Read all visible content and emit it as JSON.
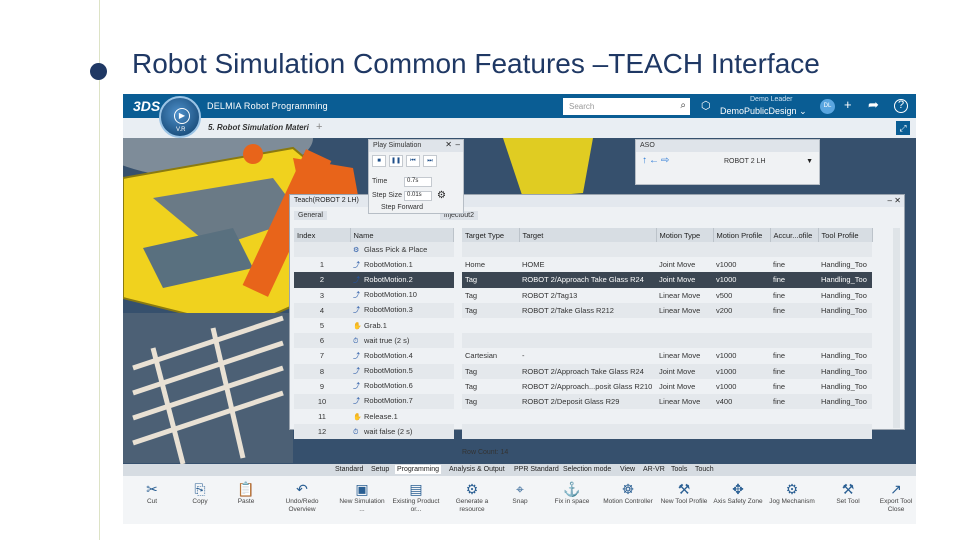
{
  "slide": {
    "title": "Robot Simulation Common Features –TEACH Interface"
  },
  "app": {
    "brand": "DELMIA Robot Programming",
    "logo": "3DS",
    "compass_version": "V.R",
    "search_placeholder": "Search",
    "user_role": "Demo Leader",
    "user_space": "DemoPublicDesign",
    "avatar_initials": "DL",
    "document_tab": "5. Robot Simulation Materi",
    "accent": "#0a5d94"
  },
  "play_simulation": {
    "title": "Play Simulation",
    "time_label": "Time",
    "time_value": "0.7s",
    "step_label": "Step Size",
    "step_value": "0.01s",
    "step_forward": "Step Forward"
  },
  "aso": {
    "title": "ASO",
    "robot": "ROBOT 2 LH"
  },
  "teach": {
    "title": "Teach(ROBOT 2 LH)",
    "tab_general": "General",
    "tab_other": "lnjectout2",
    "left_headers": [
      "Index",
      "Name"
    ],
    "right_headers": [
      "Target Type",
      "Target",
      "Motion Type",
      "Motion Profile",
      "Accur...ofile",
      "Tool Profile"
    ],
    "rows": [
      {
        "index": "",
        "name": "Glass Pick & Place",
        "target_type": "",
        "target": "",
        "motion_type": "",
        "motion_profile": "",
        "accuracy": "",
        "tool": ""
      },
      {
        "index": "1",
        "name": "RobotMotion.1",
        "target_type": "Home",
        "target": "HOME",
        "motion_type": "Joint Move",
        "motion_profile": "v1000",
        "accuracy": "fine",
        "tool": "Handling_Too"
      },
      {
        "index": "2",
        "name": "RobotMotion.2",
        "target_type": "Tag",
        "target": "ROBOT 2/Approach Take Glass R24",
        "motion_type": "Joint Move",
        "motion_profile": "v1000",
        "accuracy": "fine",
        "tool": "Handling_Too"
      },
      {
        "index": "3",
        "name": "RobotMotion.10",
        "target_type": "Tag",
        "target": "ROBOT 2/Tag13",
        "motion_type": "Linear Move",
        "motion_profile": "v500",
        "accuracy": "fine",
        "tool": "Handling_Too"
      },
      {
        "index": "4",
        "name": "RobotMotion.3",
        "target_type": "Tag",
        "target": "ROBOT 2/Take Glass R212",
        "motion_type": "Linear Move",
        "motion_profile": "v200",
        "accuracy": "fine",
        "tool": "Handling_Too"
      },
      {
        "index": "5",
        "name": "Grab.1",
        "target_type": "",
        "target": "",
        "motion_type": "",
        "motion_profile": "",
        "accuracy": "",
        "tool": ""
      },
      {
        "index": "6",
        "name": "wait true (2 s)",
        "target_type": "",
        "target": "",
        "motion_type": "",
        "motion_profile": "",
        "accuracy": "",
        "tool": ""
      },
      {
        "index": "7",
        "name": "RobotMotion.4",
        "target_type": "Cartesian",
        "target": "-",
        "motion_type": "Linear Move",
        "motion_profile": "v1000",
        "accuracy": "fine",
        "tool": "Handling_Too"
      },
      {
        "index": "8",
        "name": "RobotMotion.5",
        "target_type": "Tag",
        "target": "ROBOT 2/Approach Take Glass R24",
        "motion_type": "Joint Move",
        "motion_profile": "v1000",
        "accuracy": "fine",
        "tool": "Handling_Too"
      },
      {
        "index": "9",
        "name": "RobotMotion.6",
        "target_type": "Tag",
        "target": "ROBOT 2/Approach...posit Glass R210",
        "motion_type": "Joint Move",
        "motion_profile": "v1000",
        "accuracy": "fine",
        "tool": "Handling_Too"
      },
      {
        "index": "10",
        "name": "RobotMotion.7",
        "target_type": "Tag",
        "target": "ROBOT 2/Deposit Glass R29",
        "motion_type": "Linear Move",
        "motion_profile": "v400",
        "accuracy": "fine",
        "tool": "Handling_Too"
      },
      {
        "index": "11",
        "name": "Release.1",
        "target_type": "",
        "target": "",
        "motion_type": "",
        "motion_profile": "",
        "accuracy": "",
        "tool": ""
      },
      {
        "index": "12",
        "name": "wait false (2 s)",
        "target_type": "",
        "target": "",
        "motion_type": "",
        "motion_profile": "",
        "accuracy": "",
        "tool": ""
      }
    ],
    "row_count_label": "Row Count:",
    "row_count": "14"
  },
  "ribbon_tabs": [
    "Standard",
    "Setup",
    "Programming",
    "Analysis & Output",
    "PPR Standard",
    "Selection mode",
    "View",
    "AR-VR",
    "Tools",
    "Touch"
  ],
  "ribbon_tools": [
    {
      "label": "Cut",
      "icon": "scissors-icon"
    },
    {
      "label": "Copy",
      "icon": "copy-icon"
    },
    {
      "label": "Paste",
      "icon": "paste-icon"
    },
    {
      "label": "Undo/Redo Overview",
      "icon": "undo-icon"
    },
    {
      "label": "New Simulation ...",
      "icon": "simulation-icon"
    },
    {
      "label": "Existing Product or...",
      "icon": "product-icon"
    },
    {
      "label": "Generate a resource",
      "icon": "resource-icon"
    },
    {
      "label": "Snap",
      "icon": "snap-icon"
    },
    {
      "label": "Fix in space",
      "icon": "anchor-icon"
    },
    {
      "label": "Motion Controller",
      "icon": "controller-icon"
    },
    {
      "label": "New Tool Profile",
      "icon": "tool-profile-icon"
    },
    {
      "label": "Axis Safety Zone",
      "icon": "safety-zone-icon"
    },
    {
      "label": "Jog Mechanism",
      "icon": "jog-icon"
    },
    {
      "label": "Set Tool",
      "icon": "set-tool-icon"
    },
    {
      "label": "Export Tool Close",
      "icon": "export-icon"
    }
  ]
}
